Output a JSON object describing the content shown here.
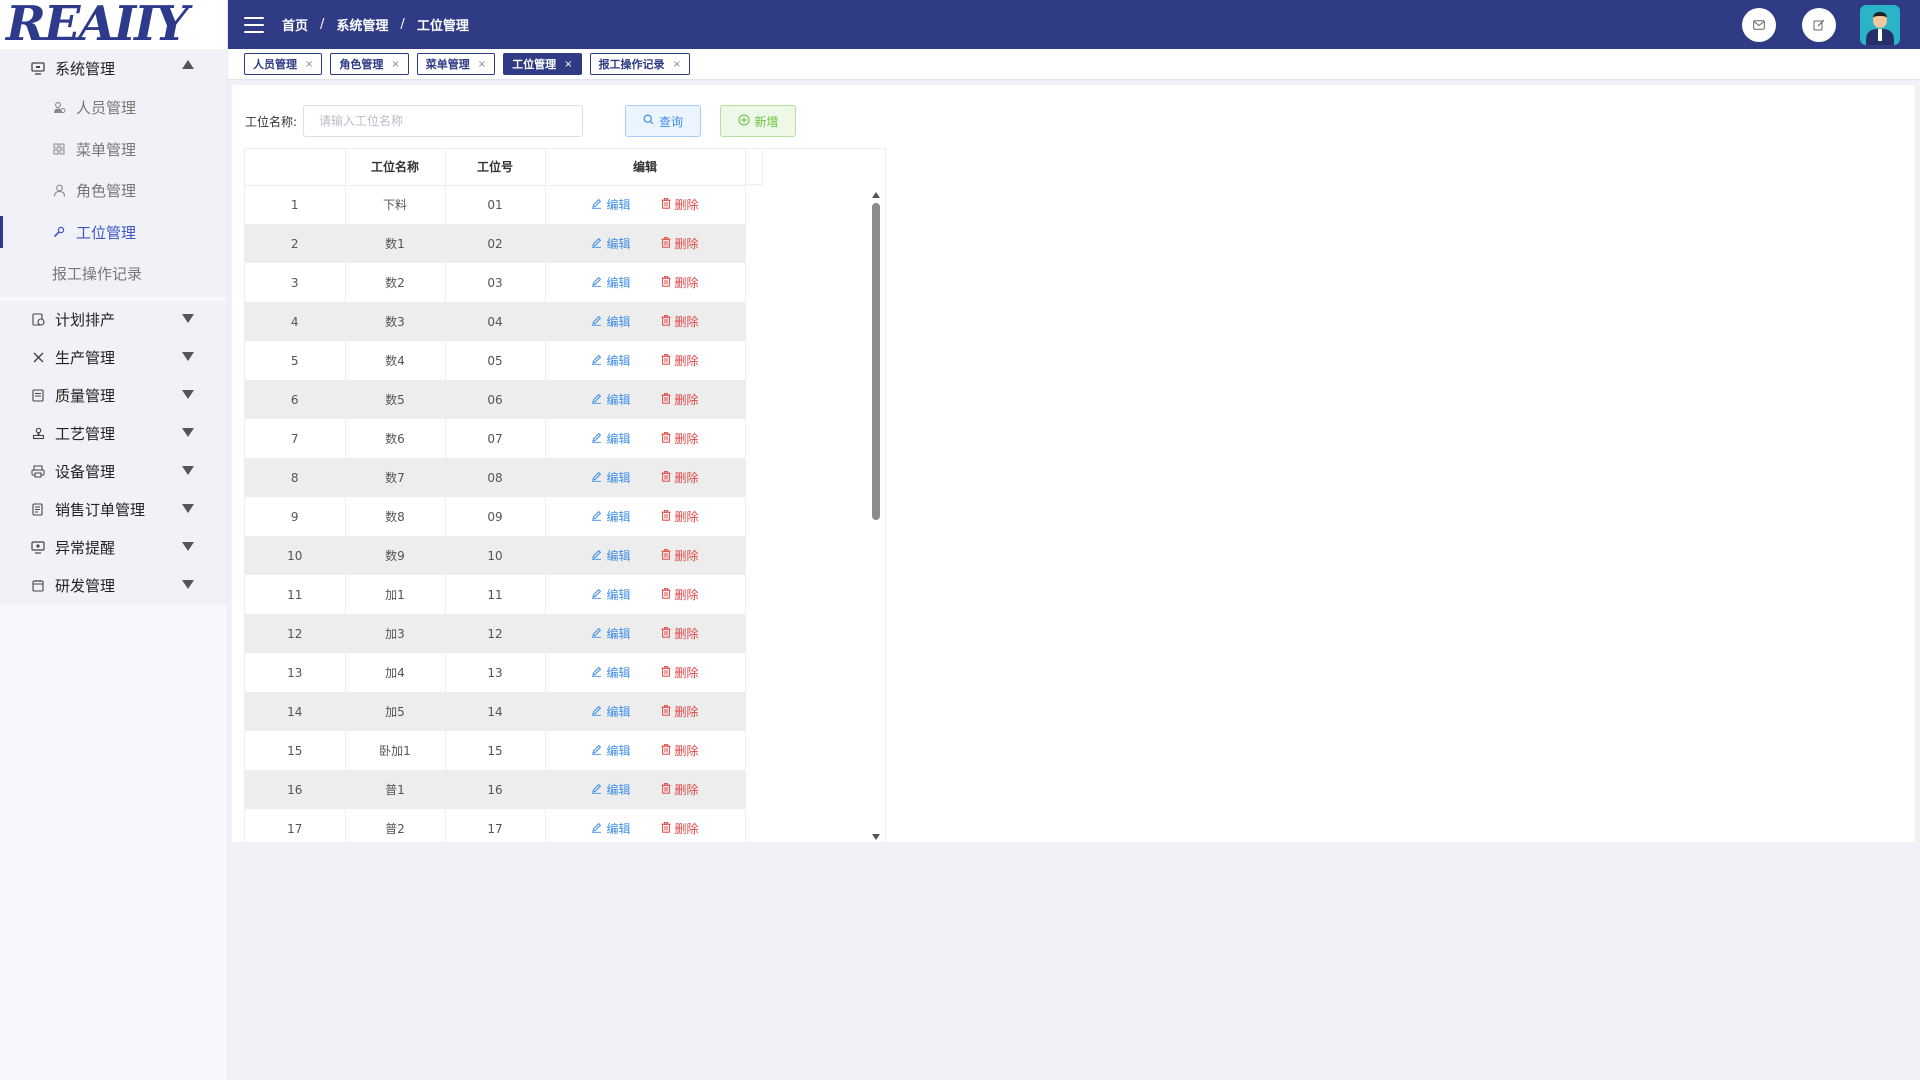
{
  "logo": {
    "text": "REAIIY"
  },
  "header": {
    "breadcrumb": [
      "首页",
      "系统管理",
      "工位管理"
    ],
    "sep": "/"
  },
  "sidebar": {
    "group": {
      "label": "系统管理",
      "icon": "monitor-icon"
    },
    "sub_items": [
      {
        "label": "人员管理",
        "icon": "users-icon"
      },
      {
        "label": "菜单管理",
        "icon": "grid-icon"
      },
      {
        "label": "角色管理",
        "icon": "user-icon"
      },
      {
        "label": "工位管理",
        "icon": "wrench-icon",
        "active": true
      },
      {
        "label": "报工操作记录",
        "icon": ""
      }
    ],
    "items": [
      {
        "label": "计划排产",
        "icon": "schedule-icon"
      },
      {
        "label": "生产管理",
        "icon": "tools-icon"
      },
      {
        "label": "质量管理",
        "icon": "document-icon"
      },
      {
        "label": "工艺管理",
        "icon": "stamp-icon"
      },
      {
        "label": "设备管理",
        "icon": "printer-icon"
      },
      {
        "label": "销售订单管理",
        "icon": "order-icon"
      },
      {
        "label": "异常提醒",
        "icon": "alert-monitor-icon"
      },
      {
        "label": "研发管理",
        "icon": "calendar-icon"
      }
    ]
  },
  "tabs": [
    {
      "label": "人员管理",
      "close": "×"
    },
    {
      "label": "角色管理",
      "close": "×"
    },
    {
      "label": "菜单管理",
      "close": "×"
    },
    {
      "label": "工位管理",
      "close": "×",
      "active": true
    },
    {
      "label": "报工操作记录",
      "close": "×"
    }
  ],
  "search": {
    "label": "工位名称:",
    "placeholder": "请输入工位名称",
    "query_label": "查询",
    "add_label": "新增"
  },
  "table": {
    "columns": [
      "",
      "工位名称",
      "工位号",
      "编辑"
    ],
    "edit_label": "编辑",
    "delete_label": "删除",
    "rows": [
      [
        "1",
        "下料",
        "01"
      ],
      [
        "2",
        "数1",
        "02"
      ],
      [
        "3",
        "数2",
        "03"
      ],
      [
        "4",
        "数3",
        "04"
      ],
      [
        "5",
        "数4",
        "05"
      ],
      [
        "6",
        "数5",
        "06"
      ],
      [
        "7",
        "数6",
        "07"
      ],
      [
        "8",
        "数7",
        "08"
      ],
      [
        "9",
        "数8",
        "09"
      ],
      [
        "10",
        "数9",
        "10"
      ],
      [
        "11",
        "加1",
        "11"
      ],
      [
        "12",
        "加3",
        "12"
      ],
      [
        "13",
        "加4",
        "13"
      ],
      [
        "14",
        "加5",
        "14"
      ],
      [
        "15",
        "卧加1",
        "15"
      ],
      [
        "16",
        "普1",
        "16"
      ],
      [
        "17",
        "普2",
        "17"
      ]
    ]
  },
  "colors": {
    "header_bg": "#2f3b84",
    "accent": "#3f8ee8",
    "danger": "#e04848",
    "success": "#67c23a"
  }
}
